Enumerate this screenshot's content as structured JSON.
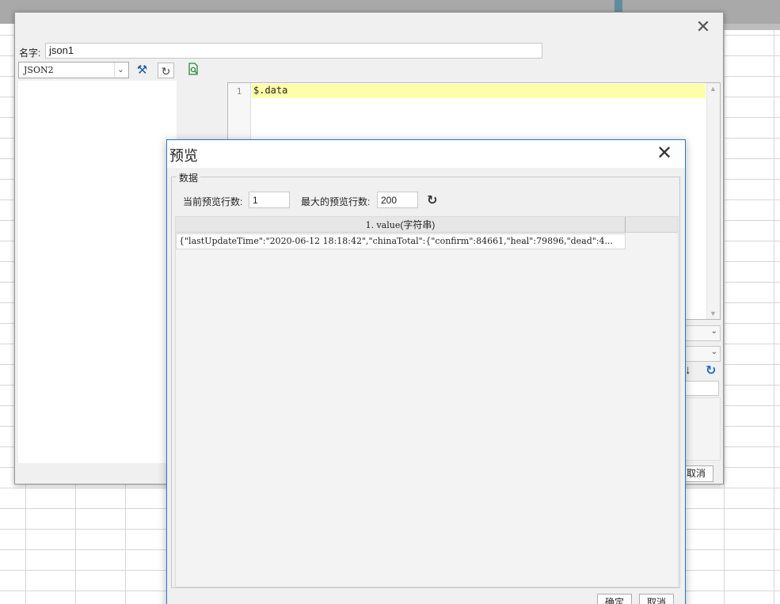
{
  "main_dialog": {
    "close_glyph": "✕",
    "name_label": "名字:",
    "name_value": "json1",
    "connection_value": "JSON2",
    "icons": [
      "settings-tools-icon",
      "refresh-icon",
      "preview-document-icon"
    ],
    "editor": {
      "line_number": "1",
      "query": "$.data"
    },
    "cancel_label": "取消"
  },
  "preview_dialog": {
    "title": "预览",
    "close_glyph": "✕",
    "group_label": "数据",
    "current_rows_label": "当前预览行数:",
    "current_rows_value": "1",
    "max_rows_label": "最大的预览行数:",
    "max_rows_value": "200",
    "table": {
      "columns": [
        {
          "index": "1.",
          "name": "value",
          "type": "(字符串)"
        }
      ],
      "rows": [
        [
          "{\"lastUpdateTime\":\"2020-06-12 18:18:42\",\"chinaTotal\":{\"confirm\":84661,\"heal\":79896,\"dead\":4..."
        ]
      ]
    },
    "ok_label": "确定",
    "cancel_label": "取消"
  },
  "colors": {
    "editor_highlight": "#ffffaa",
    "dialog_border": "#2f76c2",
    "accent_blue": "#1a6fc4"
  }
}
